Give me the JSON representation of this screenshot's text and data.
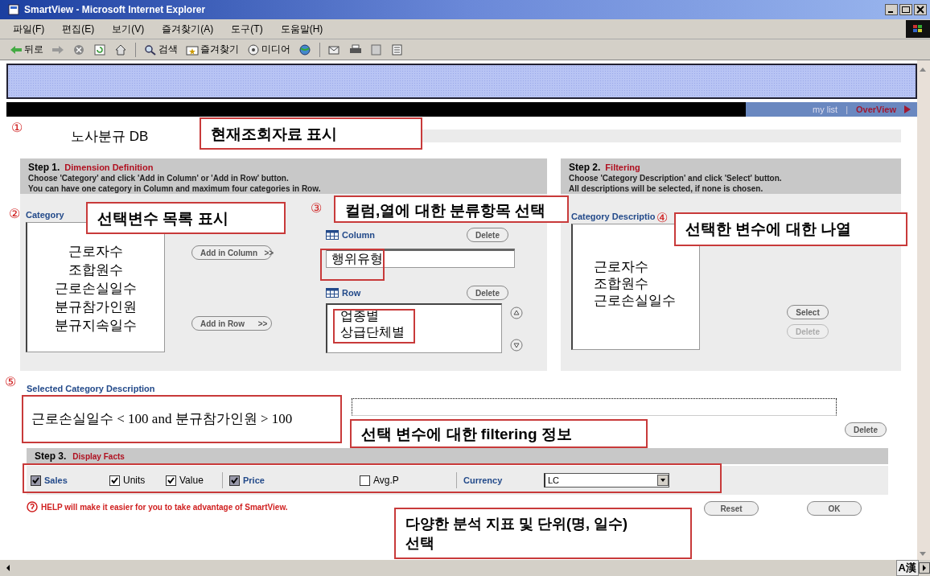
{
  "window": {
    "title": "SmartView - Microsoft Internet Explorer"
  },
  "menu": [
    "파일(F)",
    "편집(E)",
    "보기(V)",
    "즐겨찾기(A)",
    "도구(T)",
    "도움말(H)"
  ],
  "toolbar": [
    {
      "kind": "back",
      "label": "뒤로"
    },
    {
      "kind": "forward"
    },
    {
      "kind": "stop"
    },
    {
      "kind": "refresh"
    },
    {
      "kind": "home"
    },
    {
      "kind": "sep"
    },
    {
      "kind": "search",
      "label": "검색"
    },
    {
      "kind": "favorites",
      "label": "즐겨찾기"
    },
    {
      "kind": "media",
      "label": "미디어"
    },
    {
      "kind": "history"
    },
    {
      "kind": "sep"
    },
    {
      "kind": "mail"
    },
    {
      "kind": "print"
    },
    {
      "kind": "edit"
    },
    {
      "kind": "discuss"
    }
  ],
  "nav": [
    {
      "label": "my list",
      "selected": false
    },
    {
      "label": "OverView",
      "selected": true
    }
  ],
  "nav_separator": "|",
  "db_title": "노사분규 DB",
  "step1": {
    "step": "Step 1.",
    "title": "Dimension Definition",
    "instructions": [
      "Choose 'Category' and click 'Add in Column' or 'Add in Row' button.",
      "You can have one category in Column and maximum four categories in Row."
    ],
    "category_label": "Category",
    "categories": [
      "근로자수",
      "조합원수",
      "근로손실일수",
      "분규참가인원",
      "분규지속일수"
    ],
    "add_column": "Add in Column   >>",
    "add_row": "Add in Row      >>",
    "column_label": "Column",
    "column_delete": "Delete",
    "column_value": "행위유형",
    "row_label": "Row",
    "row_delete": "Delete",
    "rows": [
      "업종별",
      "상급단체별"
    ]
  },
  "step2": {
    "step": "Step 2.",
    "title": "Filtering",
    "instructions": [
      "Choose 'Category Description' and click 'Select' button.",
      "All descriptions will be selected, if none is chosen."
    ],
    "label": "Category Descriptio",
    "items": [
      "근로자수",
      "조합원수",
      "근로손실일수"
    ],
    "buttons": [
      {
        "label": "Select",
        "disabled": false
      },
      {
        "label": "Delete",
        "disabled": true
      }
    ]
  },
  "selected": {
    "label": "Selected Category Description",
    "delete": "Delete"
  },
  "step3": {
    "step": "Step 3.",
    "title": "Display Facts",
    "facts": [
      {
        "label": "Sales",
        "kind": "group",
        "checked": true
      },
      {
        "label": "Units",
        "kind": "plain",
        "checked": true
      },
      {
        "label": "Value",
        "kind": "plain",
        "checked": true
      },
      {
        "label": "Price",
        "kind": "group",
        "checked": true
      },
      {
        "label": "Avg.P",
        "kind": "plain",
        "checked": false
      }
    ],
    "currency_label": "Currency",
    "currency": "LC"
  },
  "help": "HELP will make it easier for you to take advantage of SmartView.",
  "actions": [
    "Reset",
    "OK"
  ],
  "ime": "A漢",
  "annotations": [
    {
      "kind": "marker",
      "text": "①"
    },
    {
      "kind": "callout",
      "text": "현재조회자료 표시"
    },
    {
      "kind": "marker",
      "text": "②"
    },
    {
      "kind": "callout",
      "text": "선택변수 목록 표시"
    },
    {
      "kind": "marker",
      "text": "③"
    },
    {
      "kind": "callout",
      "text": "컬럼,열에 대한 분류항목 선택"
    },
    {
      "kind": "outline"
    },
    {
      "kind": "outline"
    },
    {
      "kind": "marker",
      "text": "④"
    },
    {
      "kind": "callout",
      "text": "선택한 변수에 대한 나열"
    },
    {
      "kind": "marker",
      "text": "⑤"
    },
    {
      "kind": "value",
      "text": "근로손실일수 < 100 and 분규참가인원 > 100"
    },
    {
      "kind": "callout",
      "text": "선택 변수에 대한 filtering 정보"
    },
    {
      "kind": "outline"
    },
    {
      "kind": "callout",
      "text": "다양한 분석 지표 및 단위(명, 일수) 선택"
    }
  ]
}
